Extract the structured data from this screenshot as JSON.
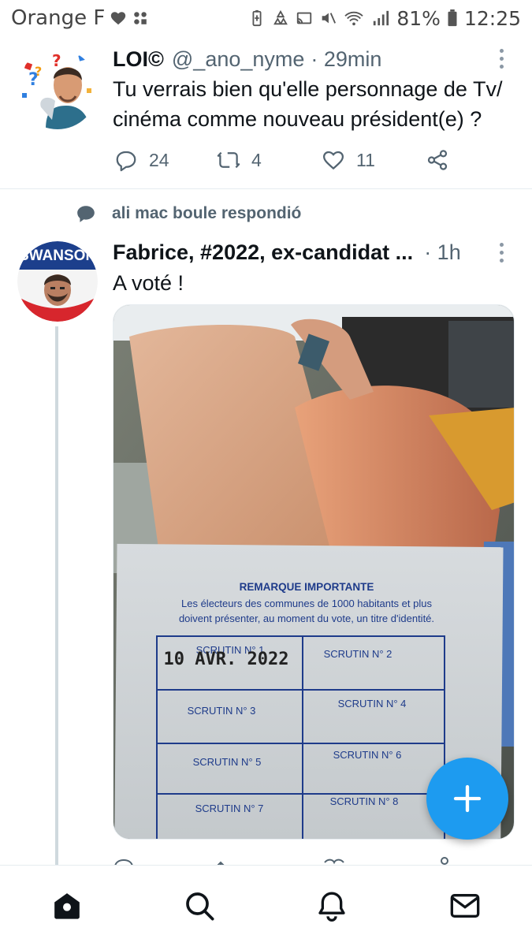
{
  "status_bar": {
    "carrier": "Orange F",
    "battery_percent": "81%",
    "time": "12:25"
  },
  "tweet1": {
    "name": "LOI©",
    "handle": "@_ano_nyme",
    "time": "· 29min",
    "text_line1": "Tu verrais bien qu'elle personnage de Tv/",
    "text_line2": "cinéma comme nouveau président(e) ?",
    "replies": "24",
    "retweets": "4",
    "likes": "11"
  },
  "reply_context": {
    "text": "ali mac boule respondió"
  },
  "tweet2": {
    "avatar_text": "SWANSON",
    "name": "Fabrice, #2022, ex-candidat ...",
    "time": "· 1h",
    "text": "A voté !",
    "media": {
      "card_title": "REMARQUE IMPORTANTE",
      "card_line1": "Les électeurs des communes de 1000 habitants et plus",
      "card_line2": "doivent présenter, au moment du vote, un titre d'identité.",
      "stamp": "10 AVR. 2022",
      "cells": [
        "SCRUTIN N° 1",
        "SCRUTIN N° 2",
        "SCRUTIN N° 3",
        "SCRUTIN N° 4",
        "SCRUTIN N° 5",
        "SCRUTIN N° 6",
        "SCRUTIN N° 7",
        "SCRUTIN N° 8"
      ]
    }
  },
  "icons": {
    "reply": "reply-icon",
    "retweet": "retweet-icon",
    "like": "heart-icon",
    "share": "share-icon",
    "compose": "plus-icon",
    "home": "home-icon",
    "search": "search-icon",
    "notifications": "bell-icon",
    "messages": "mail-icon"
  },
  "colors": {
    "accent": "#1d9bf0",
    "text_secondary": "#536471"
  }
}
